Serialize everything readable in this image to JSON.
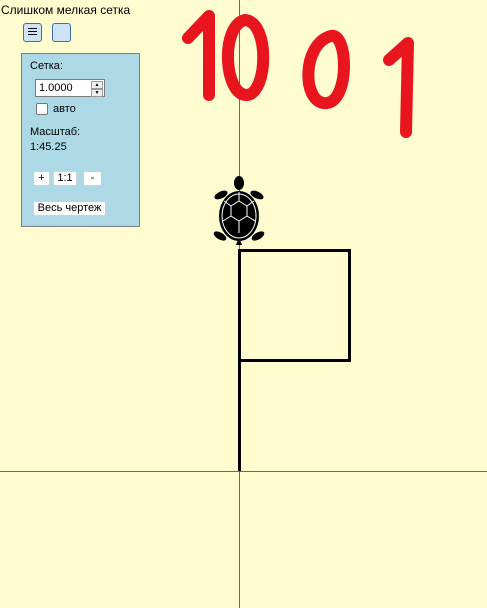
{
  "warning": "Слишком мелкая сетка",
  "panel": {
    "grid_label": "Сетка:",
    "grid_value": "1.0000",
    "auto_label": "авто",
    "auto_checked": false,
    "scale_label": "Масштаб:",
    "scale_value": "1:45.25",
    "zoom_in_label": "+",
    "zoom_reset_label": "1:1",
    "zoom_out_label": "-",
    "fit_label": "Весь чертеж"
  },
  "canvas": {
    "handwritten_text": "1001",
    "background_color": "#fffdd0",
    "axis_color": "#8b6914",
    "path_color": "#000000",
    "ink_color": "#e8141e"
  },
  "icons": {
    "menu": "hamburger-icon",
    "turtle": "turtle-icon"
  }
}
